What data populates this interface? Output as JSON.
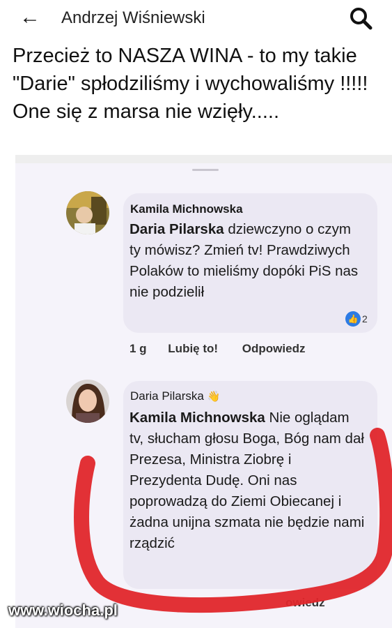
{
  "header": {
    "title": "Andrzej Wiśniewski",
    "back_icon": "arrow-left-icon",
    "search_icon": "search-icon"
  },
  "post": {
    "text": "Przecież to NASZA WINA - to my takie \"Darie\" spłodziliśmy i wychowaliśmy !!!!! One się z marsa nie wzięły....."
  },
  "comments": [
    {
      "author": "Kamila Michnowska",
      "mention": "Daria Pilarska",
      "text": " dziewczyno o czym ty mówisz? Zmień tv! Prawdziwych Polaków to mieliśmy dopóki PiS nas nie podzielił",
      "reaction_count": "2",
      "time": "1 g",
      "like_label": "Lubię to!",
      "reply_label": "Odpowiedz"
    },
    {
      "author": "Daria Pilarska",
      "mention": "Kamila Michnowska",
      "text": " Nie oglądam tv, słucham głosu Boga, Bóg nam dał Prezesa, Ministra Ziobrę i Prezydenta Dudę. Oni nas poprowadzą do Ziemi Obiecanej i żadna unijna szmata nie będzie nami rządzić",
      "badge_icon": "wave-hand-icon",
      "reply_label_partial": "owiedz"
    }
  ],
  "watermark": "www.wiocha.pl",
  "colors": {
    "bubble": "#ebe8f3",
    "annotation": "#e0262b",
    "like": "#2d7be4"
  }
}
